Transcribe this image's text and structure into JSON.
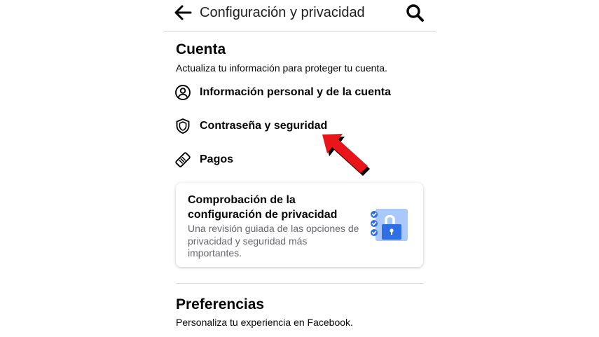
{
  "header": {
    "title": "Configuración y privacidad"
  },
  "account": {
    "title": "Cuenta",
    "subtitle": "Actualiza tu información para proteger tu cuenta.",
    "items": [
      {
        "label": "Información personal y de la cuenta",
        "icon": "user-circle-icon"
      },
      {
        "label": "Contraseña y seguridad",
        "icon": "shield-icon"
      },
      {
        "label": "Pagos",
        "icon": "tag-icon"
      }
    ]
  },
  "privacy_card": {
    "title": "Comprobación de la configuración de privacidad",
    "description": "Una revisión guiada de las opciones de privacidad y seguridad más importantes.",
    "icon": "privacy-checkup-lock-icon"
  },
  "preferences": {
    "title": "Preferencias",
    "subtitle": "Personaliza tu experiencia en Facebook."
  },
  "colors": {
    "accent_blue": "#4b8cf5",
    "annotation_red": "#e8151b"
  }
}
